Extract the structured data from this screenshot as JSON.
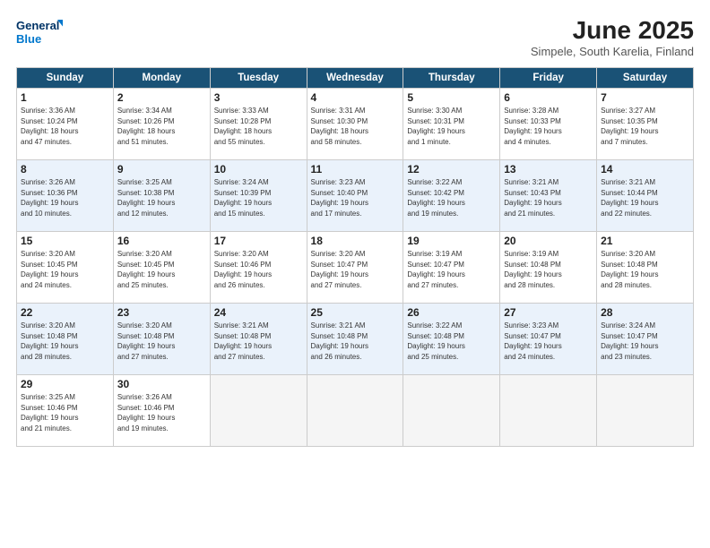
{
  "logo": {
    "line1": "General",
    "line2": "Blue"
  },
  "title": "June 2025",
  "subtitle": "Simpele, South Karelia, Finland",
  "days_of_week": [
    "Sunday",
    "Monday",
    "Tuesday",
    "Wednesday",
    "Thursday",
    "Friday",
    "Saturday"
  ],
  "weeks": [
    [
      {
        "day": "1",
        "info": "Sunrise: 3:36 AM\nSunset: 10:24 PM\nDaylight: 18 hours\nand 47 minutes."
      },
      {
        "day": "2",
        "info": "Sunrise: 3:34 AM\nSunset: 10:26 PM\nDaylight: 18 hours\nand 51 minutes."
      },
      {
        "day": "3",
        "info": "Sunrise: 3:33 AM\nSunset: 10:28 PM\nDaylight: 18 hours\nand 55 minutes."
      },
      {
        "day": "4",
        "info": "Sunrise: 3:31 AM\nSunset: 10:30 PM\nDaylight: 18 hours\nand 58 minutes."
      },
      {
        "day": "5",
        "info": "Sunrise: 3:30 AM\nSunset: 10:31 PM\nDaylight: 19 hours\nand 1 minute."
      },
      {
        "day": "6",
        "info": "Sunrise: 3:28 AM\nSunset: 10:33 PM\nDaylight: 19 hours\nand 4 minutes."
      },
      {
        "day": "7",
        "info": "Sunrise: 3:27 AM\nSunset: 10:35 PM\nDaylight: 19 hours\nand 7 minutes."
      }
    ],
    [
      {
        "day": "8",
        "info": "Sunrise: 3:26 AM\nSunset: 10:36 PM\nDaylight: 19 hours\nand 10 minutes."
      },
      {
        "day": "9",
        "info": "Sunrise: 3:25 AM\nSunset: 10:38 PM\nDaylight: 19 hours\nand 12 minutes."
      },
      {
        "day": "10",
        "info": "Sunrise: 3:24 AM\nSunset: 10:39 PM\nDaylight: 19 hours\nand 15 minutes."
      },
      {
        "day": "11",
        "info": "Sunrise: 3:23 AM\nSunset: 10:40 PM\nDaylight: 19 hours\nand 17 minutes."
      },
      {
        "day": "12",
        "info": "Sunrise: 3:22 AM\nSunset: 10:42 PM\nDaylight: 19 hours\nand 19 minutes."
      },
      {
        "day": "13",
        "info": "Sunrise: 3:21 AM\nSunset: 10:43 PM\nDaylight: 19 hours\nand 21 minutes."
      },
      {
        "day": "14",
        "info": "Sunrise: 3:21 AM\nSunset: 10:44 PM\nDaylight: 19 hours\nand 22 minutes."
      }
    ],
    [
      {
        "day": "15",
        "info": "Sunrise: 3:20 AM\nSunset: 10:45 PM\nDaylight: 19 hours\nand 24 minutes."
      },
      {
        "day": "16",
        "info": "Sunrise: 3:20 AM\nSunset: 10:45 PM\nDaylight: 19 hours\nand 25 minutes."
      },
      {
        "day": "17",
        "info": "Sunrise: 3:20 AM\nSunset: 10:46 PM\nDaylight: 19 hours\nand 26 minutes."
      },
      {
        "day": "18",
        "info": "Sunrise: 3:20 AM\nSunset: 10:47 PM\nDaylight: 19 hours\nand 27 minutes."
      },
      {
        "day": "19",
        "info": "Sunrise: 3:19 AM\nSunset: 10:47 PM\nDaylight: 19 hours\nand 27 minutes."
      },
      {
        "day": "20",
        "info": "Sunrise: 3:19 AM\nSunset: 10:48 PM\nDaylight: 19 hours\nand 28 minutes."
      },
      {
        "day": "21",
        "info": "Sunrise: 3:20 AM\nSunset: 10:48 PM\nDaylight: 19 hours\nand 28 minutes."
      }
    ],
    [
      {
        "day": "22",
        "info": "Sunrise: 3:20 AM\nSunset: 10:48 PM\nDaylight: 19 hours\nand 28 minutes."
      },
      {
        "day": "23",
        "info": "Sunrise: 3:20 AM\nSunset: 10:48 PM\nDaylight: 19 hours\nand 27 minutes."
      },
      {
        "day": "24",
        "info": "Sunrise: 3:21 AM\nSunset: 10:48 PM\nDaylight: 19 hours\nand 27 minutes."
      },
      {
        "day": "25",
        "info": "Sunrise: 3:21 AM\nSunset: 10:48 PM\nDaylight: 19 hours\nand 26 minutes."
      },
      {
        "day": "26",
        "info": "Sunrise: 3:22 AM\nSunset: 10:48 PM\nDaylight: 19 hours\nand 25 minutes."
      },
      {
        "day": "27",
        "info": "Sunrise: 3:23 AM\nSunset: 10:47 PM\nDaylight: 19 hours\nand 24 minutes."
      },
      {
        "day": "28",
        "info": "Sunrise: 3:24 AM\nSunset: 10:47 PM\nDaylight: 19 hours\nand 23 minutes."
      }
    ],
    [
      {
        "day": "29",
        "info": "Sunrise: 3:25 AM\nSunset: 10:46 PM\nDaylight: 19 hours\nand 21 minutes."
      },
      {
        "day": "30",
        "info": "Sunrise: 3:26 AM\nSunset: 10:46 PM\nDaylight: 19 hours\nand 19 minutes."
      },
      {
        "day": "",
        "info": ""
      },
      {
        "day": "",
        "info": ""
      },
      {
        "day": "",
        "info": ""
      },
      {
        "day": "",
        "info": ""
      },
      {
        "day": "",
        "info": ""
      }
    ]
  ]
}
